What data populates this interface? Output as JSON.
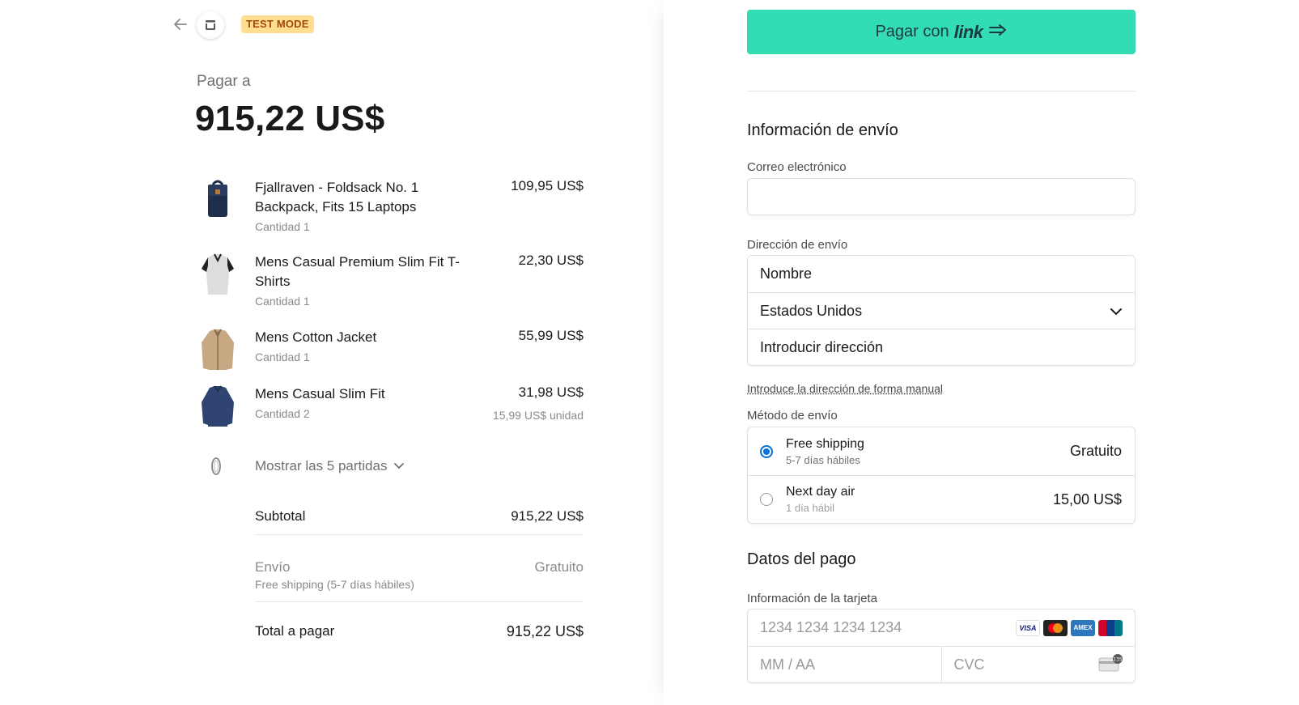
{
  "header": {
    "test_mode_label": "TEST MODE"
  },
  "summary": {
    "pay_to_label": "Pagar a",
    "total_amount": "915,22 US$",
    "items": [
      {
        "name": "Fjallraven - Foldsack No. 1 Backpack, Fits 15 Laptops",
        "qty": "Cantidad 1",
        "price": "109,95 US$",
        "unit_price": ""
      },
      {
        "name": "Mens Casual Premium Slim Fit T-Shirts",
        "qty": "Cantidad 1",
        "price": "22,30 US$",
        "unit_price": ""
      },
      {
        "name": "Mens Cotton Jacket",
        "qty": "Cantidad 1",
        "price": "55,99 US$",
        "unit_price": ""
      },
      {
        "name": "Mens Casual Slim Fit",
        "qty": "Cantidad 2",
        "price": "31,98 US$",
        "unit_price": "15,99 US$ unidad"
      }
    ],
    "show_more_label": "Mostrar las 5 partidas",
    "subtotal_label": "Subtotal",
    "subtotal_value": "915,22 US$",
    "shipping_label": "Envío",
    "shipping_value": "Gratuito",
    "shipping_method_note": "Free shipping (5-7 días hábiles)",
    "total_label": "Total a pagar",
    "total_value": "915,22 US$"
  },
  "checkout": {
    "link_button_prefix": "Pagar con",
    "link_button_logo": "link",
    "shipping_info_title": "Información de envío",
    "email_label": "Correo electrónico",
    "email_value": "",
    "address_label": "Dirección de envío",
    "name_placeholder": "Nombre",
    "country_value": "Estados Unidos",
    "address_placeholder": "Introducir dirección",
    "manual_address_link": "Introduce la dirección de forma manual",
    "shipping_method_label": "Método de envío",
    "shipping_options": [
      {
        "name": "Free shipping",
        "eta": "5-7 días hábiles",
        "price": "Gratuito",
        "selected": true
      },
      {
        "name": "Next day air",
        "eta": "1 día hábil",
        "price": "15,00 US$",
        "selected": false
      }
    ],
    "payment_title": "Datos del pago",
    "card_info_label": "Información de la tarjeta",
    "card_number_placeholder": "1234 1234 1234 1234",
    "expiry_placeholder": "MM / AA",
    "cvc_placeholder": "CVC",
    "card_brands": [
      "VISA",
      "mastercard",
      "AMEX",
      "UnionPay"
    ]
  },
  "colors": {
    "link_button": "#33ddb3",
    "test_badge_bg": "#ffde92",
    "test_badge_text": "#a2470e",
    "radio_selected": "#0570de"
  }
}
